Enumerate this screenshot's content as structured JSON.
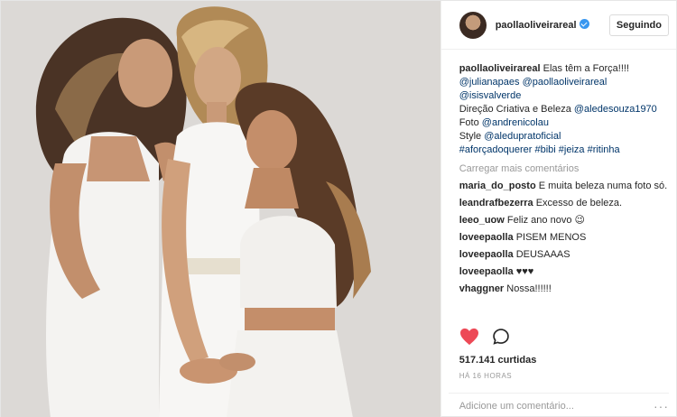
{
  "post": {
    "username": "paollaoliveirareal",
    "follow_label": "Seguindo",
    "caption": {
      "author": "paollaoliveirareal",
      "text": "Elas têm a Força!!!!",
      "mentions_line1": "@julianapaes @paollaoliveirareal",
      "mentions_line2": "@isisvalverde",
      "direction_label": "Direção Criativa e Beleza",
      "direction_tag": "@aledesouza1970",
      "photo_label": "Foto",
      "photo_tag": "@andrenicolau",
      "style_label": "Style",
      "style_tag": "@aleduprатoficial",
      "hashtags": "#aforçadoquerer #bibi #jeiza #ritinha"
    },
    "load_more": "Carregar mais comentários",
    "comments": [
      {
        "user": "maria_do_posto",
        "text": "E muita beleza numa foto só."
      },
      {
        "user": "leandrafbezerra",
        "text": "Excesso de beleza."
      },
      {
        "user": "leeo_uow",
        "text": "Feliz ano novo 😉"
      },
      {
        "user": "loveepaolla",
        "text": "PISEM MENOS"
      },
      {
        "user": "loveepaolla",
        "text": "DEUSAAAS"
      },
      {
        "user": "loveepaolla",
        "text": "♥♥♥"
      },
      {
        "user": "vhaggner",
        "text": "Nossa!!!!!!"
      }
    ],
    "likes": "517.141 curtidas",
    "time": "HÁ 16 HORAS",
    "comment_placeholder": "Adicione um comentário...",
    "more_options": "···"
  },
  "icons": {
    "like": "heart-icon",
    "comment": "comment-bubble-icon",
    "verified": "verified-badge-icon",
    "options": "more-dots-icon"
  },
  "colors": {
    "heart": "#ed4956",
    "verified": "#3897f0",
    "tag": "#003569",
    "muted": "#999999"
  }
}
